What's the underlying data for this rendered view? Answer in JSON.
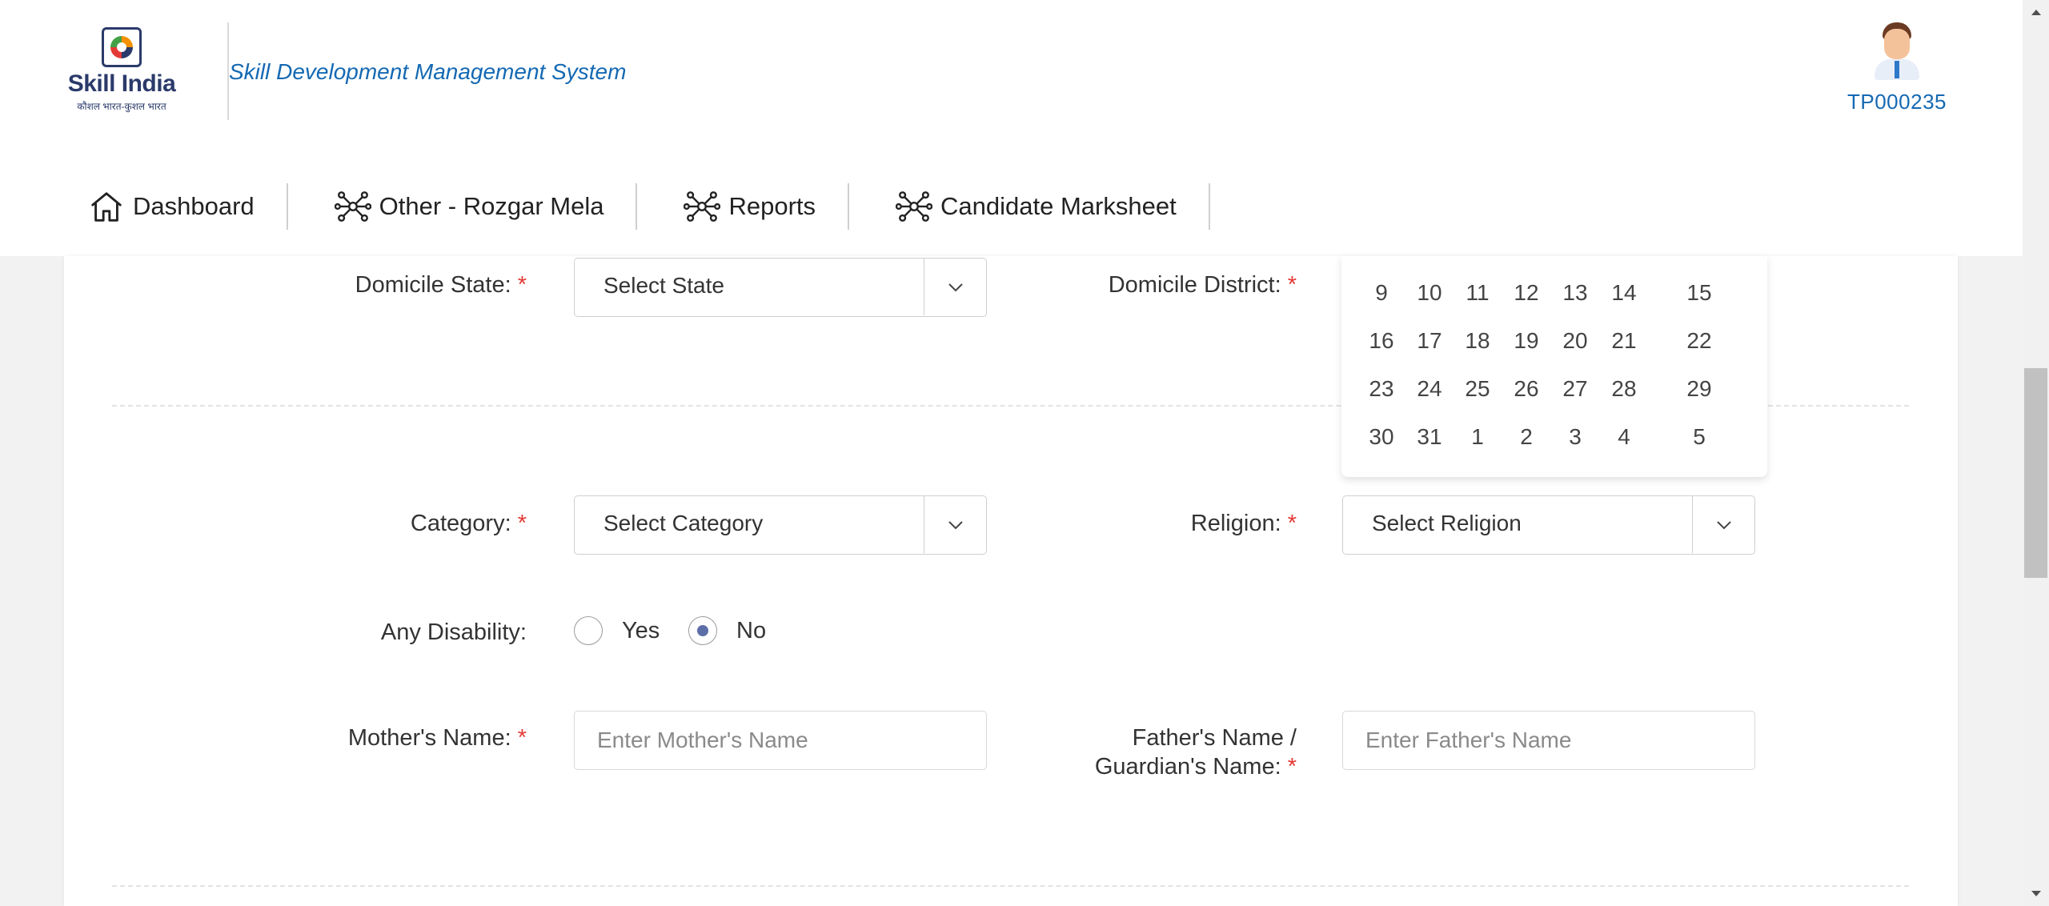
{
  "header": {
    "logo_text": "Skill India",
    "logo_subtext": "कौशल भारत-कुशल भारत",
    "system_title": "Skill Development Management System",
    "user_id": "TP000235"
  },
  "nav": {
    "items": [
      {
        "label": "Dashboard",
        "icon": "home-icon"
      },
      {
        "label": "Other - Rozgar Mela",
        "icon": "network-icon"
      },
      {
        "label": "Reports",
        "icon": "network-icon"
      },
      {
        "label": "Candidate Marksheet",
        "icon": "network-icon"
      }
    ]
  },
  "form": {
    "domicile_state_label": "Domicile State:",
    "domicile_state_value": "Select State",
    "domicile_district_label": "Domicile District:",
    "category_label": "Category:",
    "category_value": "Select Category",
    "religion_label": "Religion:",
    "religion_value": "Select Religion",
    "disability_label": "Any Disability:",
    "disability_yes": "Yes",
    "disability_no": "No",
    "disability_selected": "No",
    "mother_label": "Mother's Name:",
    "mother_placeholder": "Enter Mother's Name",
    "father_label_line1": "Father's Name /",
    "father_label_line2": "Guardian's Name:",
    "father_placeholder": "Enter Father's Name",
    "required_mark": "*"
  },
  "calendar": {
    "weeks": [
      [
        "9",
        "10",
        "11",
        "12",
        "13",
        "14",
        "15"
      ],
      [
        "16",
        "17",
        "18",
        "19",
        "20",
        "21",
        "22"
      ],
      [
        "23",
        "24",
        "25",
        "26",
        "27",
        "28",
        "29"
      ],
      [
        "30",
        "31",
        "1",
        "2",
        "3",
        "4",
        "5"
      ]
    ]
  },
  "colors": {
    "brand_blue": "#1469b3",
    "required_red": "#e53935",
    "radio_dot": "#5b6ea8"
  }
}
